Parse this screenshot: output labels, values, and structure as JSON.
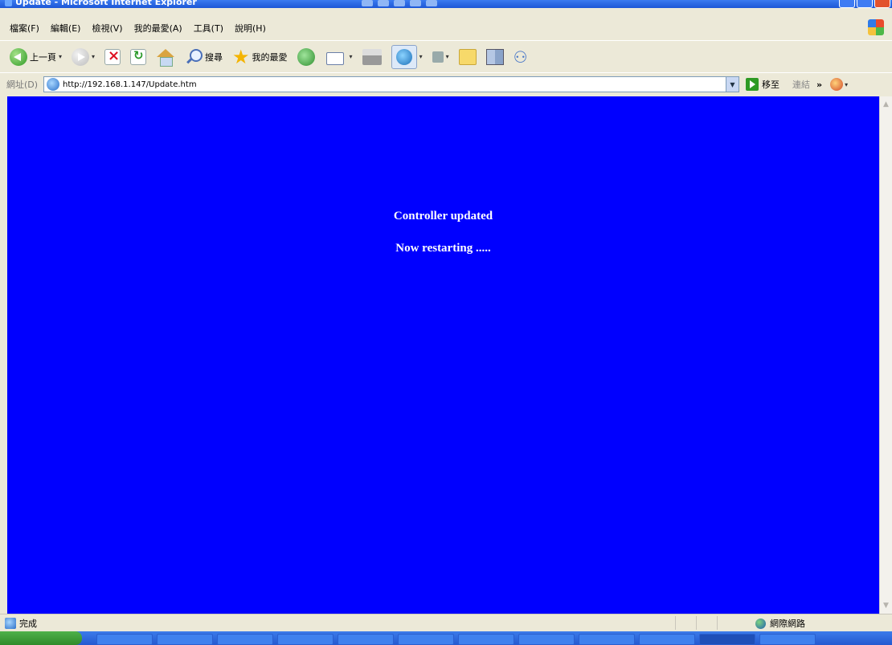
{
  "window": {
    "title": "Update - Microsoft Internet Explorer"
  },
  "menu": [
    {
      "label": "檔案(F)"
    },
    {
      "label": "編輯(E)"
    },
    {
      "label": "檢視(V)"
    },
    {
      "label": "我的最愛(A)"
    },
    {
      "label": "工具(T)"
    },
    {
      "label": "說明(H)"
    }
  ],
  "toolbar": {
    "back_label": "上一頁",
    "search_label": "搜尋",
    "favorites_label": "我的最愛"
  },
  "address": {
    "label": "網址(D)",
    "url": "http://192.168.1.147/Update.htm",
    "go_label": "移至",
    "links_label": "連結",
    "more": "»"
  },
  "content": {
    "line1": "Controller updated",
    "line2": "Now restarting .....",
    "background": "#0000ff",
    "text_color": "#ffffff"
  },
  "status": {
    "text": "完成",
    "zone": "網際網路"
  },
  "icons": {
    "back": "back-arrow-icon",
    "forward": "forward-arrow-icon",
    "stop": "stop-icon",
    "refresh": "refresh-icon",
    "home": "home-icon",
    "search": "search-icon",
    "favorites": "star-icon",
    "history": "history-icon",
    "mail": "mail-icon",
    "print": "print-icon",
    "messenger": "messenger-icon",
    "zone": "globe-icon"
  }
}
